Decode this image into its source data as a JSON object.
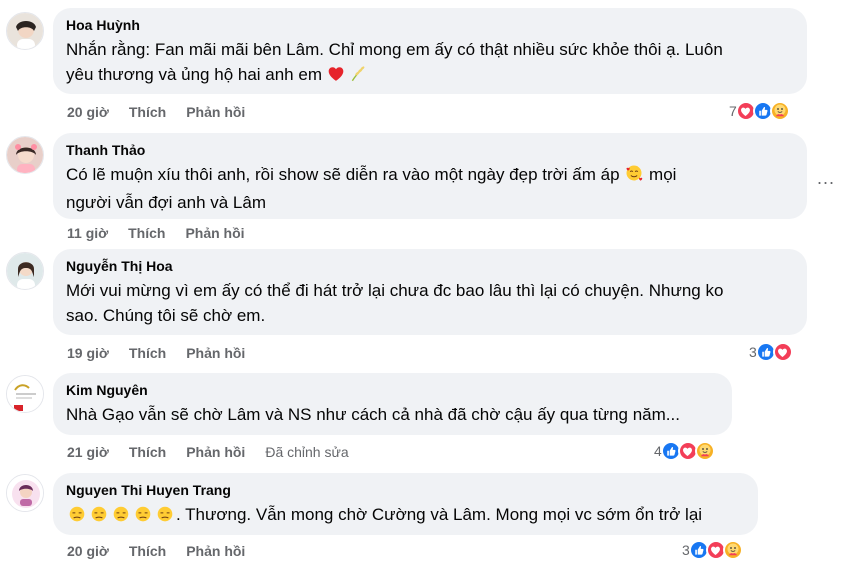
{
  "comments": [
    {
      "author": "Hoa Huỳnh",
      "text_line1": "Nhắn rằng: Fan mãi mãi bên Lâm. Chỉ mong em ấy có thật nhiều sức khỏe thôi ạ. Luôn",
      "text_line2": "yêu thương và ủng hộ hai anh em",
      "time": "20 giờ",
      "like": "Thích",
      "reply": "Phản hồi",
      "reaction_count": "7",
      "reaction_icons": [
        "like-icon",
        "love-icon",
        "care-icon"
      ]
    },
    {
      "author": "Thanh Thảo",
      "text_line1": "Có lẽ muộn xíu thôi anh, rồi show sẽ diễn ra vào một ngày đẹp trời ấm áp",
      "text_line1_tail": "mọi",
      "text_line2": "người vẫn đợi anh và Lâm",
      "time": "11 giờ",
      "like": "Thích",
      "reply": "Phản hồi"
    },
    {
      "author": "Nguyễn Thị Hoa",
      "text_line1": "Mới vui mừng vì em ấy có thể đi hát trở lại chưa đc bao lâu thì lại có chuyện. Nhưng ko",
      "text_line2": "sao. Chúng tôi sẽ chờ em.",
      "time": "19 giờ",
      "like": "Thích",
      "reply": "Phản hồi",
      "reaction_count": "3",
      "reaction_icons": [
        "like-icon",
        "love-icon"
      ]
    },
    {
      "author": "Kim Nguyên",
      "text_line1": "Nhà Gạo vẫn sẽ chờ Lâm và NS như cách cả nhà đã chờ cậu ấy qua từng năm...",
      "time": "21 giờ",
      "like": "Thích",
      "reply": "Phản hồi",
      "edited": "Đã chỉnh sửa",
      "reaction_count": "4",
      "reaction_icons": [
        "like-icon",
        "love-icon",
        "care-icon"
      ]
    },
    {
      "author": "Nguyen Thi Huyen Trang",
      "text_line1": ". Thương. Vẫn mong chờ Cường và Lâm. Mong mọi vc sớm ổn trở lại",
      "time": "20 giờ",
      "like": "Thích",
      "reply": "Phản hồi",
      "reaction_count": "3",
      "reaction_icons": [
        "like-icon",
        "love-icon",
        "care-icon"
      ]
    }
  ],
  "colors": {
    "bubble": "#f0f2f5",
    "meta": "#65676b",
    "like": "#1877f2",
    "love": "#f33e58",
    "care": "#f7b125"
  },
  "more_menu": "..."
}
